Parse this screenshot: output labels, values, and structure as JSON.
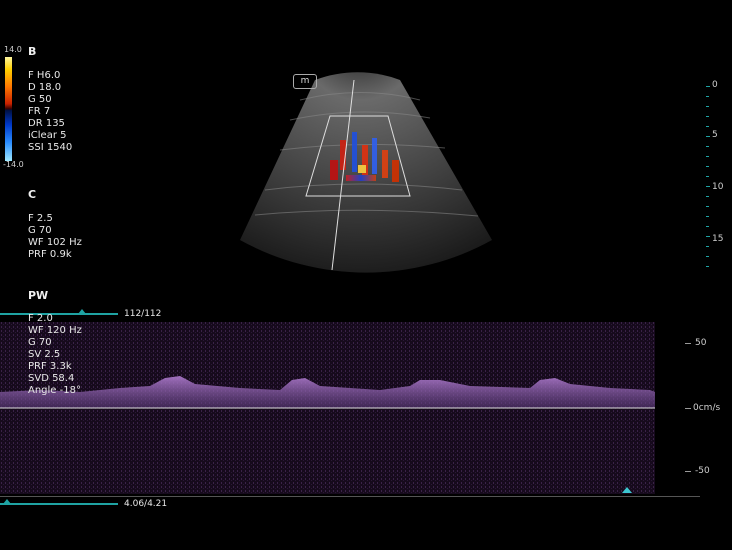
{
  "bmode": {
    "header": "B",
    "params": [
      "F H6.0",
      "D 18.0",
      "G 50",
      "FR 7",
      "DR 135",
      "iClear 5",
      "SSI 1540"
    ],
    "colorbar_max": "14.0",
    "colorbar_min": "-14.0",
    "mark_label": "m",
    "depth_labels": [
      "0",
      "5",
      "10",
      "15"
    ]
  },
  "color_mode": {
    "header": "C",
    "params": [
      "F 2.5",
      "G 70",
      "WF 102 Hz",
      "PRF 0.9k"
    ]
  },
  "pw_mode": {
    "header": "PW",
    "params": [
      "F 2.0",
      "WF 120 Hz",
      "G 70",
      "SV 2.5",
      "PRF 3.3k",
      "SVD 58.4",
      "Angle   -18°"
    ],
    "frame_counter": "112/112",
    "time_counter": "4.06/4.21",
    "scale_labels": [
      "50",
      "0cm/s",
      "-50"
    ]
  },
  "colors": {
    "accent": "#1fa3a3",
    "doppler_fill": "#8a5aa8",
    "background": "#000000"
  }
}
